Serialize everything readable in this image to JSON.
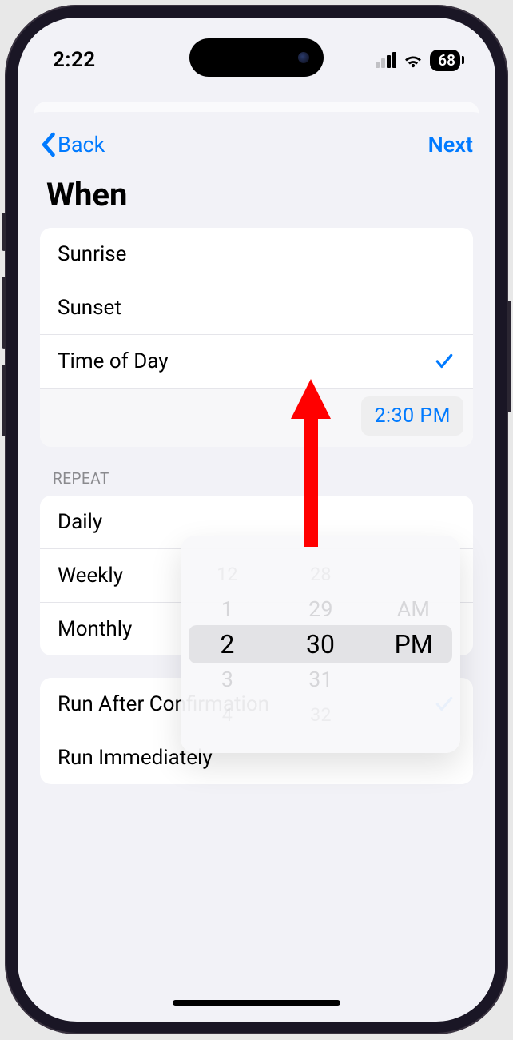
{
  "status": {
    "time": "2:22",
    "battery": "68"
  },
  "nav": {
    "back": "Back",
    "next": "Next"
  },
  "title": "When",
  "when_options": {
    "sunrise": "Sunrise",
    "sunset": "Sunset",
    "time_of_day": "Time of Day",
    "time_value": "2:30 PM"
  },
  "repeat": {
    "header": "REPEAT",
    "daily": "Daily",
    "weekly": "Weekly",
    "monthly": "Monthly"
  },
  "run": {
    "after_confirmation": "Run After Confirmation",
    "immediately": "Run Immediately"
  },
  "picker": {
    "hours": [
      "12",
      "1",
      "2",
      "3",
      "4"
    ],
    "minutes": [
      "28",
      "29",
      "30",
      "31",
      "32"
    ],
    "ampm_top": "AM",
    "ampm_sel": "PM"
  },
  "annotation": {
    "arrow_color": "#ff0000"
  }
}
